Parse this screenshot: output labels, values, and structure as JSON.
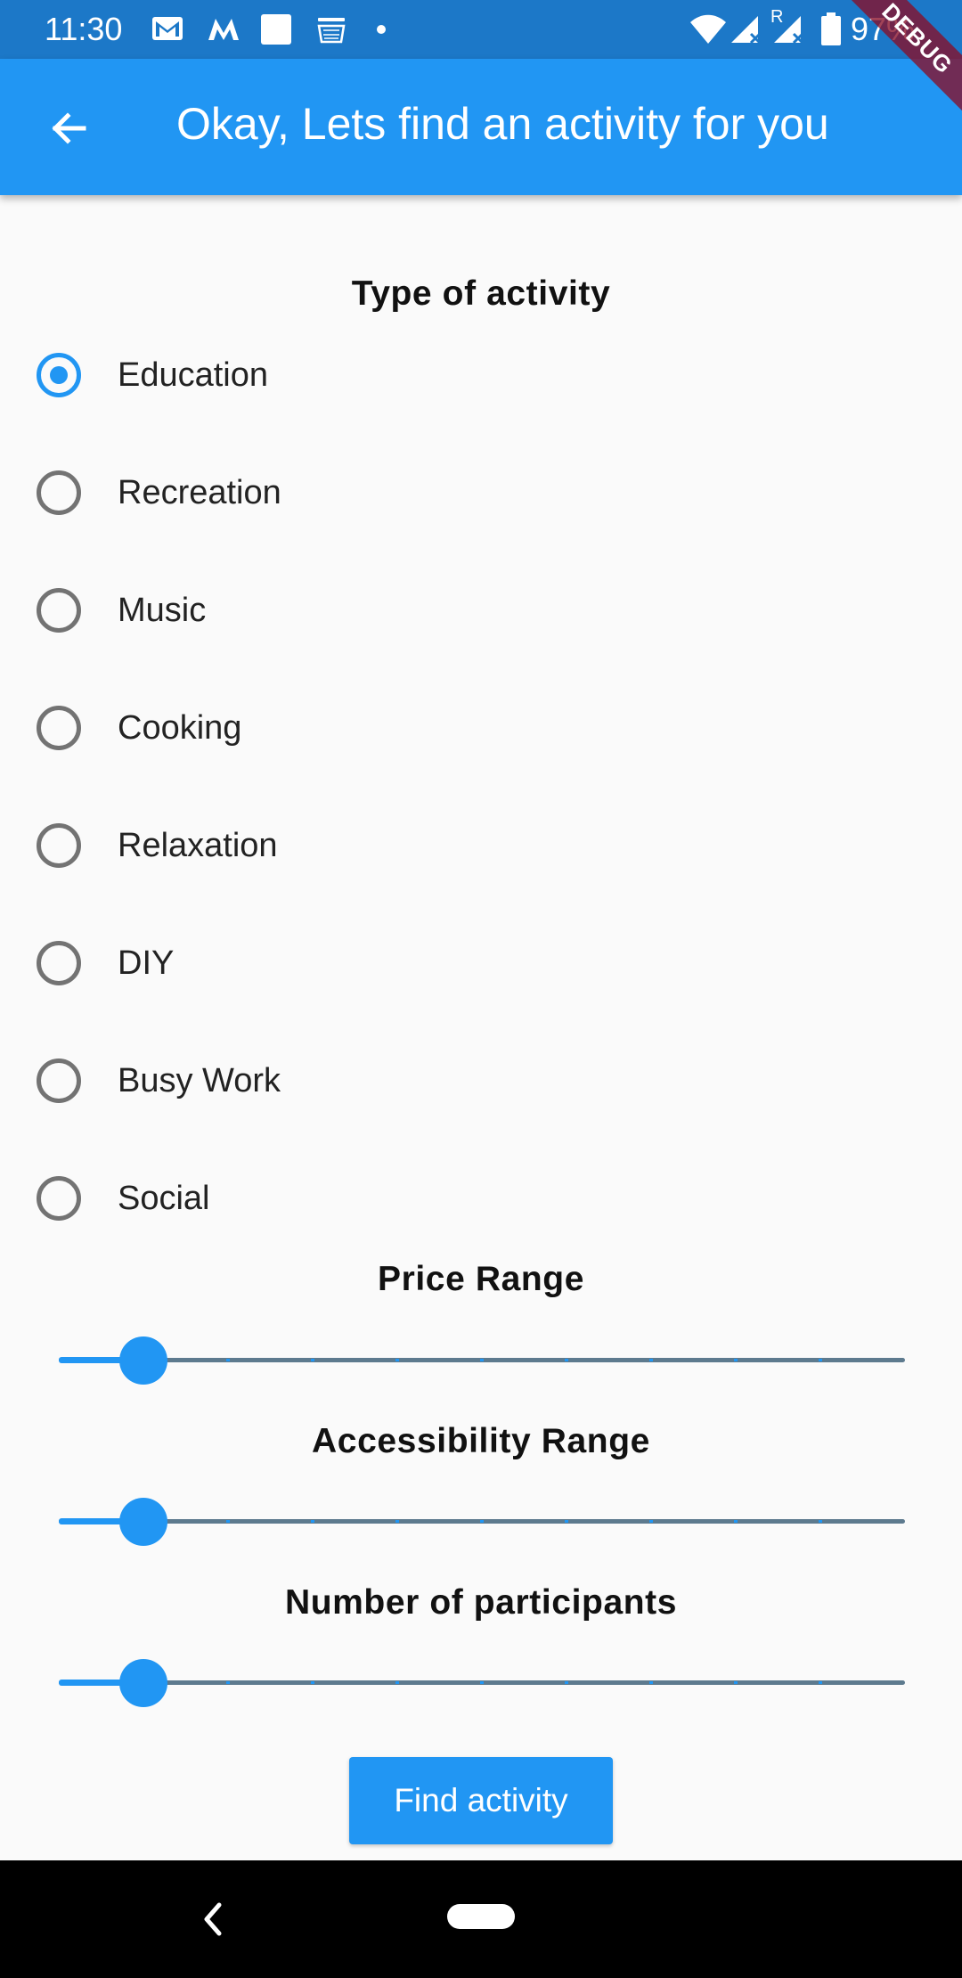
{
  "status_bar": {
    "time": "11:30",
    "battery_text": "97%",
    "icons_left": [
      "gmail-icon",
      "myntra-icon",
      "app-square-icon",
      "amazon-icon",
      "notification-dot-icon"
    ],
    "icons_right": [
      "wifi-icon",
      "signal-icon",
      "roaming-signal-icon",
      "battery-icon"
    ]
  },
  "app_bar": {
    "title": "Okay, Lets find an activity for you",
    "back_icon": "arrow-back-icon"
  },
  "debug_banner": "DEBUG",
  "activity_type": {
    "title": "Type of activity",
    "selected": "Education",
    "options": [
      {
        "label": "Education",
        "selected": true
      },
      {
        "label": "Recreation",
        "selected": false
      },
      {
        "label": "Music",
        "selected": false
      },
      {
        "label": "Cooking",
        "selected": false
      },
      {
        "label": "Relaxation",
        "selected": false
      },
      {
        "label": "DIY",
        "selected": false
      },
      {
        "label": "Busy Work",
        "selected": false
      },
      {
        "label": "Social",
        "selected": false
      }
    ]
  },
  "sliders": [
    {
      "title": "Price Range",
      "value": 0.1,
      "divisions": 10
    },
    {
      "title": "Accessibility Range",
      "value": 0.1,
      "divisions": 10
    },
    {
      "title": "Number of participants",
      "value": 0.1,
      "divisions": 10
    }
  ],
  "button": {
    "label": "Find activity"
  },
  "nav_bar": {
    "icons": [
      "nav-back-icon",
      "nav-home-pill-icon"
    ]
  },
  "colors": {
    "primary": "#2196f3",
    "status_bar": "#1c78c8",
    "inactive_track": "#5d7a8e",
    "radio_unselected": "#737373",
    "background": "#fafafa",
    "debug_banner": "#880e28"
  }
}
